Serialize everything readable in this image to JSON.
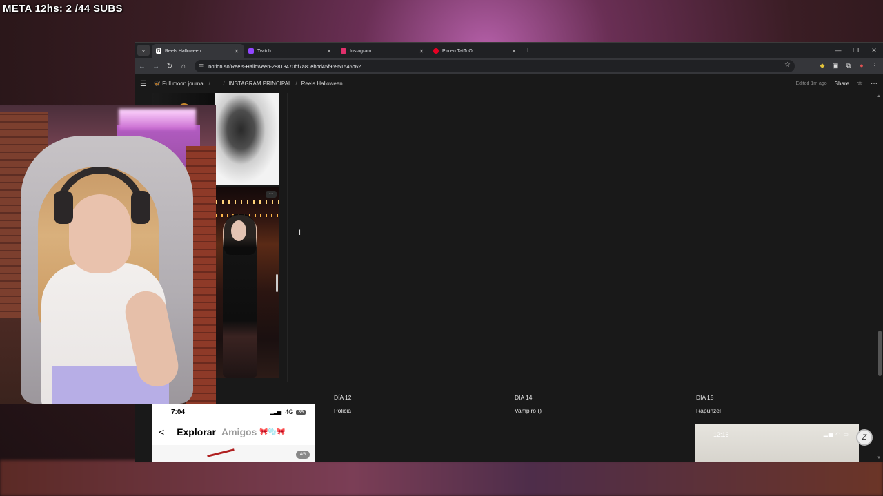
{
  "stream_overlay": {
    "text": "META 12hs: 2 /44 SUBS"
  },
  "browser": {
    "tabs": [
      {
        "label": "Reels Halloween",
        "icon": "notion-icon",
        "color": "#ffffff",
        "active": true
      },
      {
        "label": "Twitch",
        "icon": "twitch-icon",
        "color": "#9146ff",
        "active": false
      },
      {
        "label": "Instagram",
        "icon": "instagram-icon",
        "color": "#e1306c",
        "active": false
      },
      {
        "label": "Pin en TatToO",
        "icon": "pinterest-icon",
        "color": "#e60023",
        "active": false
      }
    ],
    "new_tab": "+",
    "url": "notion.so/Reels-Halloween-28818470bf7a80ebbd45f96951546b62"
  },
  "notion": {
    "breadcrumb": [
      "Full moon journal",
      "...",
      "INSTAGRAM PRINCIPAL",
      "Reels Halloween"
    ],
    "edited": "Edited 1m ago",
    "share": "Share",
    "days": [
      {
        "title": "DÍA 12",
        "subtitle": "Policia"
      },
      {
        "title": "DIA 14",
        "subtitle": "Vampiro ()"
      },
      {
        "title": "DIA 15",
        "subtitle": "Rapunzel"
      }
    ],
    "card_menu": "···"
  },
  "phone_one": {
    "time": "7:04",
    "network": "4G",
    "battery": "39",
    "tab_explore": "Explorar",
    "tab_friends": "Amigos",
    "friends_emoji": "🎀🫧🎀",
    "counter": "4/8"
  },
  "phone_two": {
    "time": "12:16"
  }
}
